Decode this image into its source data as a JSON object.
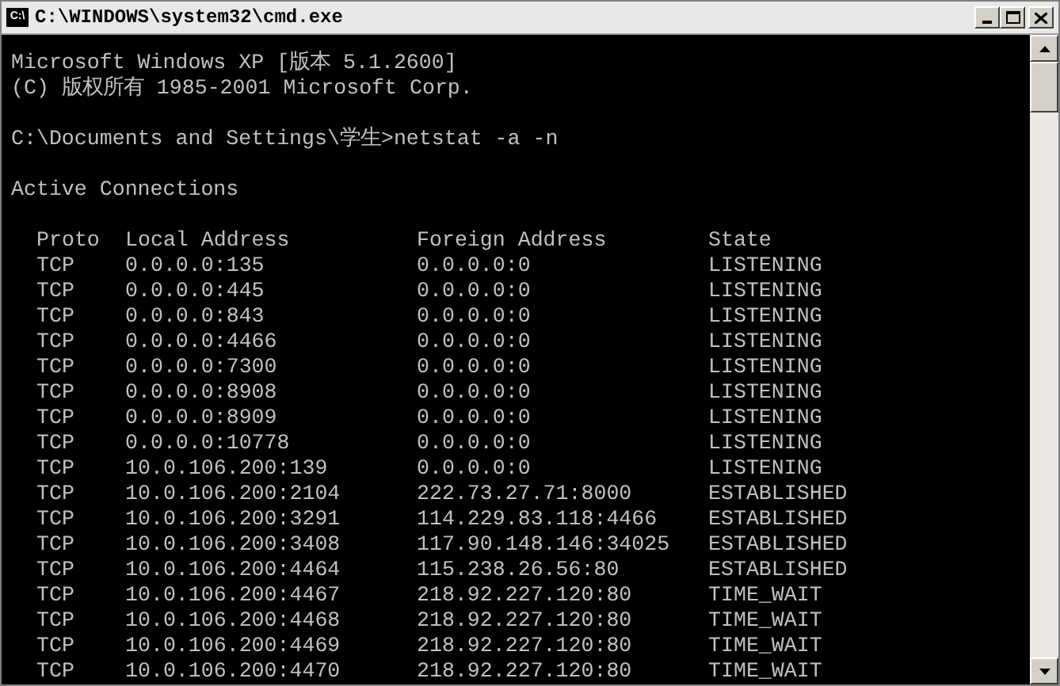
{
  "window": {
    "title": "C:\\WINDOWS\\system32\\cmd.exe",
    "icon_text": "C:\\"
  },
  "console_blocks": [
    [
      "Microsoft Windows XP [版本 5.1.2600]",
      "(C) 版权所有 1985-2001 Microsoft Corp."
    ],
    [
      "C:\\Documents and Settings\\学生>netstat -a -n"
    ],
    [
      "Active Connections"
    ]
  ],
  "table": {
    "columns": [
      "Proto",
      "Local Address",
      "Foreign Address",
      "State"
    ],
    "rows": [
      [
        "TCP",
        "0.0.0.0:135",
        "0.0.0.0:0",
        "LISTENING"
      ],
      [
        "TCP",
        "0.0.0.0:445",
        "0.0.0.0:0",
        "LISTENING"
      ],
      [
        "TCP",
        "0.0.0.0:843",
        "0.0.0.0:0",
        "LISTENING"
      ],
      [
        "TCP",
        "0.0.0.0:4466",
        "0.0.0.0:0",
        "LISTENING"
      ],
      [
        "TCP",
        "0.0.0.0:7300",
        "0.0.0.0:0",
        "LISTENING"
      ],
      [
        "TCP",
        "0.0.0.0:8908",
        "0.0.0.0:0",
        "LISTENING"
      ],
      [
        "TCP",
        "0.0.0.0:8909",
        "0.0.0.0:0",
        "LISTENING"
      ],
      [
        "TCP",
        "0.0.0.0:10778",
        "0.0.0.0:0",
        "LISTENING"
      ],
      [
        "TCP",
        "10.0.106.200:139",
        "0.0.0.0:0",
        "LISTENING"
      ],
      [
        "TCP",
        "10.0.106.200:2104",
        "222.73.27.71:8000",
        "ESTABLISHED"
      ],
      [
        "TCP",
        "10.0.106.200:3291",
        "114.229.83.118:4466",
        "ESTABLISHED"
      ],
      [
        "TCP",
        "10.0.106.200:3408",
        "117.90.148.146:34025",
        "ESTABLISHED"
      ],
      [
        "TCP",
        "10.0.106.200:4464",
        "115.238.26.56:80",
        "ESTABLISHED"
      ],
      [
        "TCP",
        "10.0.106.200:4467",
        "218.92.227.120:80",
        "TIME_WAIT"
      ],
      [
        "TCP",
        "10.0.106.200:4468",
        "218.92.227.120:80",
        "TIME_WAIT"
      ],
      [
        "TCP",
        "10.0.106.200:4469",
        "218.92.227.120:80",
        "TIME_WAIT"
      ],
      [
        "TCP",
        "10.0.106.200:4470",
        "218.92.227.120:80",
        "TIME_WAIT"
      ]
    ]
  }
}
